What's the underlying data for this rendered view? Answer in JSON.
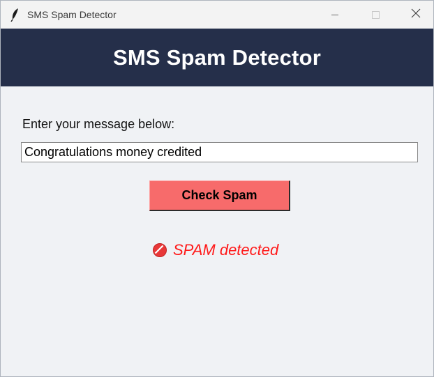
{
  "window": {
    "title": "SMS Spam Detector",
    "icon": "feather-icon"
  },
  "header": {
    "title": "SMS Spam Detector",
    "background": "#252f4a"
  },
  "form": {
    "prompt_label": "Enter your message below:",
    "message_value": "Congratulations money credited",
    "check_button_label": "Check Spam",
    "check_button_color": "#f76b6b"
  },
  "result": {
    "icon": "no-entry-icon",
    "text": "SPAM detected",
    "color": "#ff1a1a"
  }
}
